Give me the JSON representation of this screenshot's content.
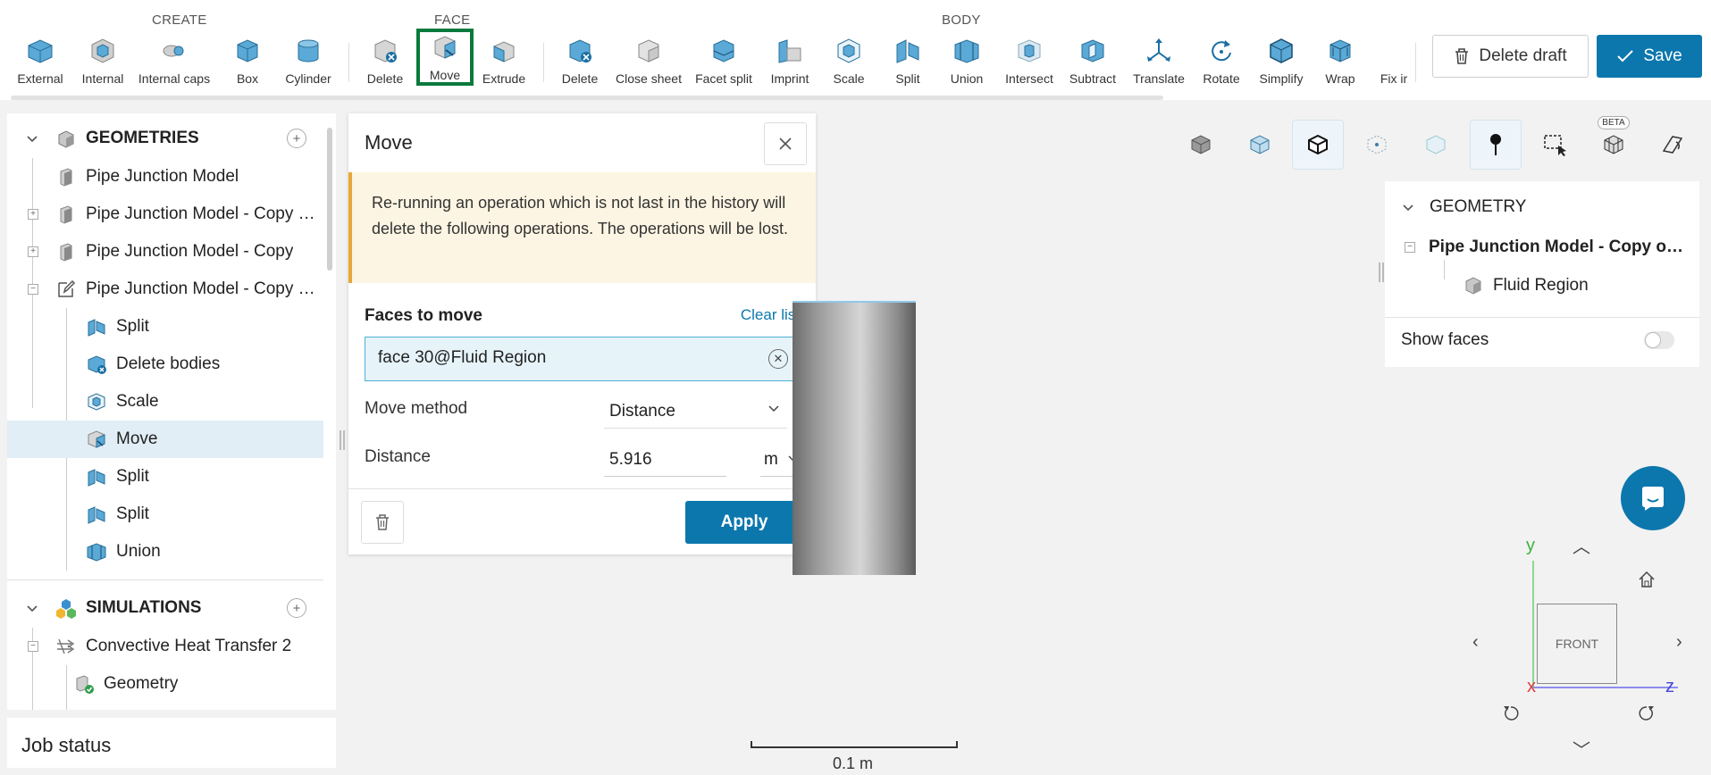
{
  "toolbar": {
    "groups": {
      "create": "CREATE",
      "face": "FACE",
      "body": "BODY"
    },
    "create_tools": [
      "External",
      "Internal",
      "Internal caps",
      "Box",
      "Cylinder"
    ],
    "face_tools": [
      "Delete",
      "Move",
      "Extrude"
    ],
    "body_tools": [
      "Delete",
      "Close sheet",
      "Facet split",
      "Imprint",
      "Scale",
      "Split",
      "Union",
      "Intersect",
      "Subtract",
      "Translate",
      "Rotate",
      "Simplify",
      "Wrap",
      "Fix ir"
    ],
    "active_tool": "Move",
    "delete_draft_label": "Delete draft",
    "save_label": "Save"
  },
  "tree": {
    "geometries_label": "GEOMETRIES",
    "geometries": [
      "Pipe Junction Model",
      "Pipe Junction Model - Copy of Fluid Region",
      "Pipe Junction Model - Copy",
      "Pipe Junction Model - Copy of Fluid Region"
    ],
    "operations": [
      "Split",
      "Delete bodies",
      "Scale",
      "Move",
      "Split",
      "Split",
      "Union"
    ],
    "selected_operation": "Move",
    "simulations_label": "SIMULATIONS",
    "simulations": [
      "Convective Heat Transfer 2"
    ],
    "sim_children": [
      "Geometry"
    ]
  },
  "job_status": "Job status",
  "move_panel": {
    "title": "Move",
    "warning": "Re-running an operation which is not last in the history will delete the following operations. The operations will be lost.",
    "faces_label": "Faces to move",
    "clear_list": "Clear list",
    "face_value": "face 30@Fluid Region",
    "method_label": "Move method",
    "method_value": "Distance",
    "distance_label": "Distance",
    "distance_value": "5.916",
    "distance_unit": "m",
    "apply_label": "Apply"
  },
  "viewer": {
    "beta_label": "BETA",
    "geometry_panel": {
      "title": "GEOMETRY",
      "model": "Pipe Junction Model - Copy of Fluid Region",
      "region": "Fluid Region",
      "show_faces_label": "Show faces",
      "show_faces_on": false
    },
    "nav_cube_label": "FRONT",
    "axis": {
      "y": "y",
      "x": "x",
      "z": "z"
    },
    "scale_label": "0.1 m"
  },
  "colors": {
    "accent": "#0c77ad",
    "active_outline": "#0a7a3c",
    "warning_bg": "#fdf5e3",
    "warning_border": "#e8a838"
  }
}
